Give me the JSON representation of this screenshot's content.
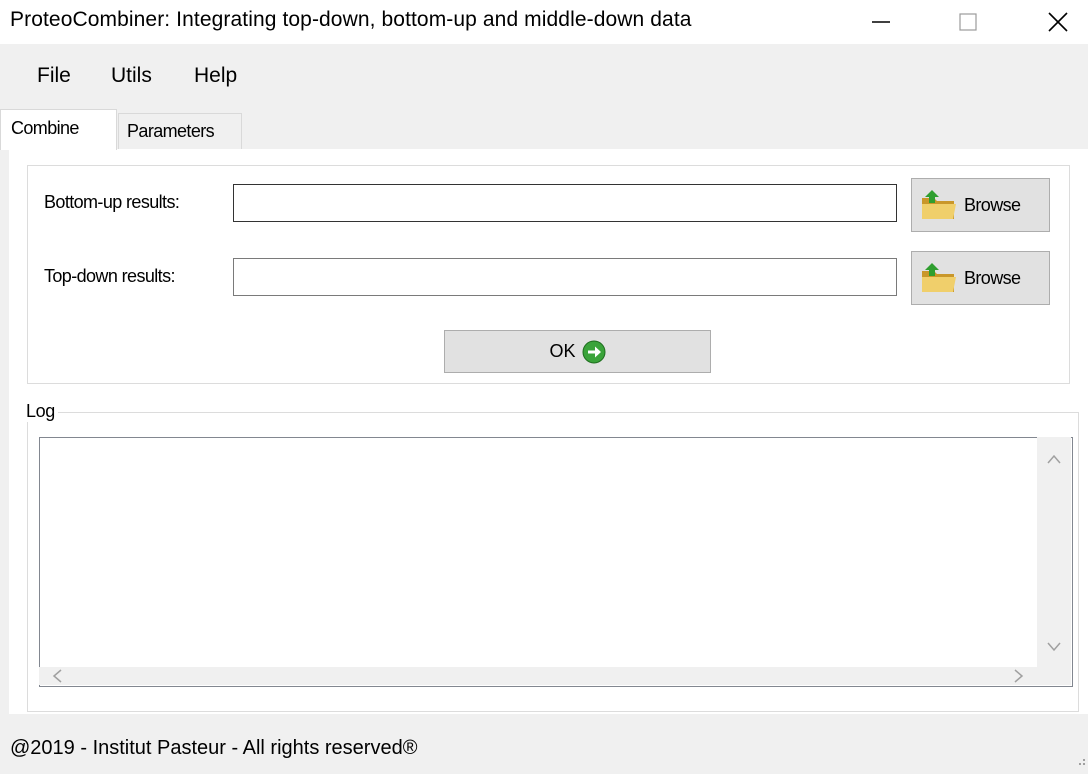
{
  "window": {
    "title": "ProteoCombiner: Integrating top-down, bottom-up and middle-down data",
    "controls": [
      "minimize-icon",
      "maximize-icon",
      "close-icon"
    ]
  },
  "menu": {
    "items": [
      "File",
      "Utils",
      "Help"
    ]
  },
  "tabs": [
    {
      "label": "Combine",
      "active": true
    },
    {
      "label": "Parameters",
      "active": false
    }
  ],
  "form": {
    "bottom_up_label": "Bottom-up results:",
    "bottom_up_value": "",
    "top_down_label": "Top-down results:",
    "top_down_value": "",
    "browse_label": "Browse",
    "browse_icon": "folder-open-icon",
    "ok_label": "OK",
    "ok_icon": "green-arrow-right-icon"
  },
  "log": {
    "legend": "Log",
    "content": ""
  },
  "status": {
    "text": "@2019 - Institut Pasteur - All rights reserved®"
  },
  "colors": {
    "button_face": "#e1e1e1",
    "button_border": "#adadad",
    "ok_icon_green": "#3aa33a",
    "folder_yellow": "#e8c25a"
  }
}
